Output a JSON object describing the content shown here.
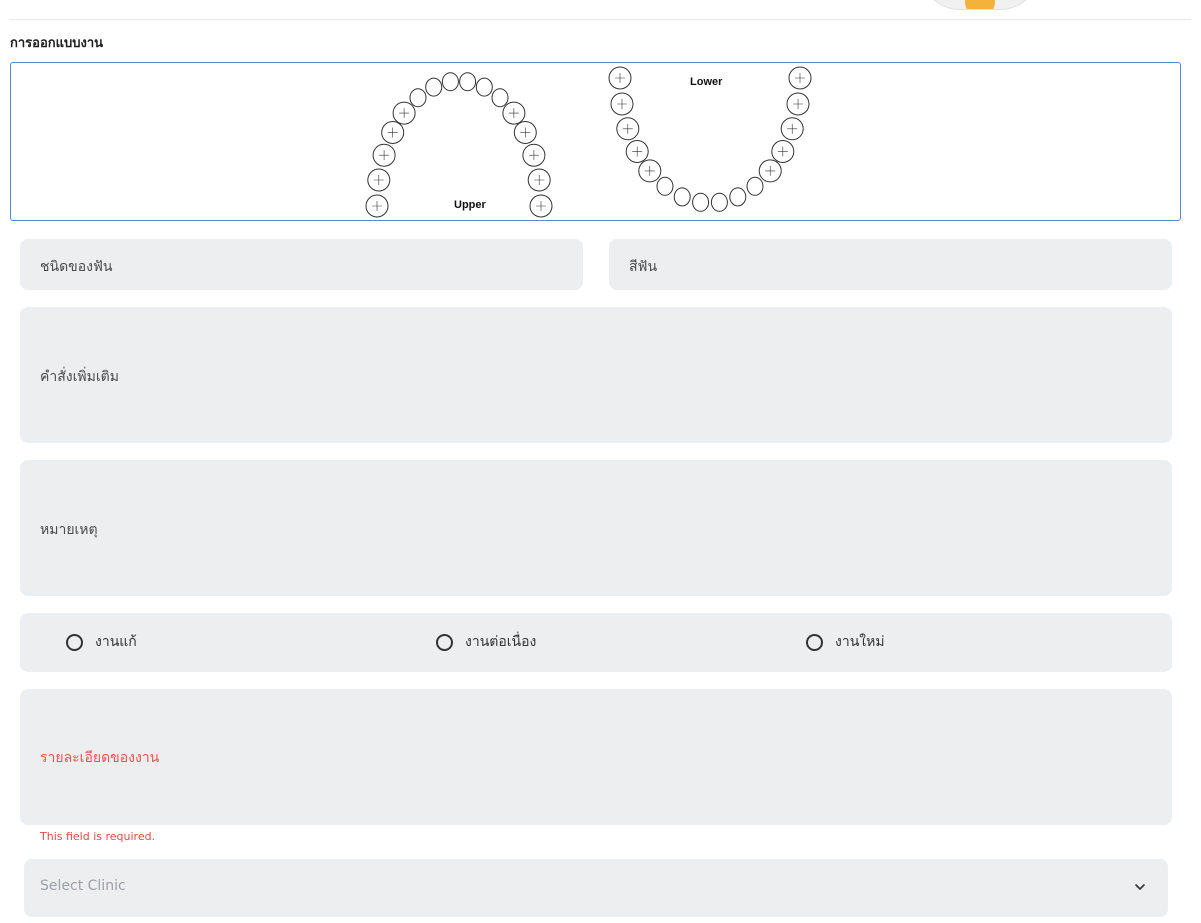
{
  "section": {
    "title": "การออกแบบงาน"
  },
  "tooth_chart": {
    "upper_label": "Upper",
    "lower_label": "Lower"
  },
  "fields": {
    "tooth_type": {
      "placeholder": "ชนิดของฟัน"
    },
    "tooth_color": {
      "placeholder": "สีฟัน"
    },
    "extra_instructions": {
      "placeholder": "คำสั่งเพิ่มเติม"
    },
    "remark": {
      "placeholder": "หมายเหตุ"
    },
    "work_detail": {
      "placeholder": "รายละเอียดของงาน",
      "error": "This field is required."
    }
  },
  "work_type": {
    "options": [
      {
        "label": "งานแก้",
        "selected": false
      },
      {
        "label": "งานต่อเนื่อง",
        "selected": false
      },
      {
        "label": "งานใหม่",
        "selected": false
      }
    ]
  },
  "clinic_select": {
    "placeholder": "Select Clinic",
    "icon": "chevron-down-icon"
  },
  "colors": {
    "error": "#f0524d",
    "field_bg": "#eceef0",
    "chart_border": "#5b87c9"
  }
}
